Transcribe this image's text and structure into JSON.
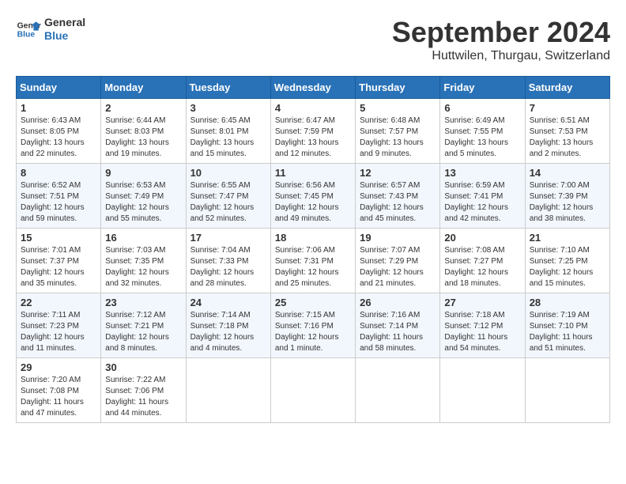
{
  "logo": {
    "line1": "General",
    "line2": "Blue"
  },
  "title": "September 2024",
  "subtitle": "Huttwilen, Thurgau, Switzerland",
  "headers": [
    "Sunday",
    "Monday",
    "Tuesday",
    "Wednesday",
    "Thursday",
    "Friday",
    "Saturday"
  ],
  "weeks": [
    [
      {
        "day": "1",
        "lines": [
          "Sunrise: 6:43 AM",
          "Sunset: 8:05 PM",
          "Daylight: 13 hours",
          "and 22 minutes."
        ]
      },
      {
        "day": "2",
        "lines": [
          "Sunrise: 6:44 AM",
          "Sunset: 8:03 PM",
          "Daylight: 13 hours",
          "and 19 minutes."
        ]
      },
      {
        "day": "3",
        "lines": [
          "Sunrise: 6:45 AM",
          "Sunset: 8:01 PM",
          "Daylight: 13 hours",
          "and 15 minutes."
        ]
      },
      {
        "day": "4",
        "lines": [
          "Sunrise: 6:47 AM",
          "Sunset: 7:59 PM",
          "Daylight: 13 hours",
          "and 12 minutes."
        ]
      },
      {
        "day": "5",
        "lines": [
          "Sunrise: 6:48 AM",
          "Sunset: 7:57 PM",
          "Daylight: 13 hours",
          "and 9 minutes."
        ]
      },
      {
        "day": "6",
        "lines": [
          "Sunrise: 6:49 AM",
          "Sunset: 7:55 PM",
          "Daylight: 13 hours",
          "and 5 minutes."
        ]
      },
      {
        "day": "7",
        "lines": [
          "Sunrise: 6:51 AM",
          "Sunset: 7:53 PM",
          "Daylight: 13 hours",
          "and 2 minutes."
        ]
      }
    ],
    [
      {
        "day": "8",
        "lines": [
          "Sunrise: 6:52 AM",
          "Sunset: 7:51 PM",
          "Daylight: 12 hours",
          "and 59 minutes."
        ]
      },
      {
        "day": "9",
        "lines": [
          "Sunrise: 6:53 AM",
          "Sunset: 7:49 PM",
          "Daylight: 12 hours",
          "and 55 minutes."
        ]
      },
      {
        "day": "10",
        "lines": [
          "Sunrise: 6:55 AM",
          "Sunset: 7:47 PM",
          "Daylight: 12 hours",
          "and 52 minutes."
        ]
      },
      {
        "day": "11",
        "lines": [
          "Sunrise: 6:56 AM",
          "Sunset: 7:45 PM",
          "Daylight: 12 hours",
          "and 49 minutes."
        ]
      },
      {
        "day": "12",
        "lines": [
          "Sunrise: 6:57 AM",
          "Sunset: 7:43 PM",
          "Daylight: 12 hours",
          "and 45 minutes."
        ]
      },
      {
        "day": "13",
        "lines": [
          "Sunrise: 6:59 AM",
          "Sunset: 7:41 PM",
          "Daylight: 12 hours",
          "and 42 minutes."
        ]
      },
      {
        "day": "14",
        "lines": [
          "Sunrise: 7:00 AM",
          "Sunset: 7:39 PM",
          "Daylight: 12 hours",
          "and 38 minutes."
        ]
      }
    ],
    [
      {
        "day": "15",
        "lines": [
          "Sunrise: 7:01 AM",
          "Sunset: 7:37 PM",
          "Daylight: 12 hours",
          "and 35 minutes."
        ]
      },
      {
        "day": "16",
        "lines": [
          "Sunrise: 7:03 AM",
          "Sunset: 7:35 PM",
          "Daylight: 12 hours",
          "and 32 minutes."
        ]
      },
      {
        "day": "17",
        "lines": [
          "Sunrise: 7:04 AM",
          "Sunset: 7:33 PM",
          "Daylight: 12 hours",
          "and 28 minutes."
        ]
      },
      {
        "day": "18",
        "lines": [
          "Sunrise: 7:06 AM",
          "Sunset: 7:31 PM",
          "Daylight: 12 hours",
          "and 25 minutes."
        ]
      },
      {
        "day": "19",
        "lines": [
          "Sunrise: 7:07 AM",
          "Sunset: 7:29 PM",
          "Daylight: 12 hours",
          "and 21 minutes."
        ]
      },
      {
        "day": "20",
        "lines": [
          "Sunrise: 7:08 AM",
          "Sunset: 7:27 PM",
          "Daylight: 12 hours",
          "and 18 minutes."
        ]
      },
      {
        "day": "21",
        "lines": [
          "Sunrise: 7:10 AM",
          "Sunset: 7:25 PM",
          "Daylight: 12 hours",
          "and 15 minutes."
        ]
      }
    ],
    [
      {
        "day": "22",
        "lines": [
          "Sunrise: 7:11 AM",
          "Sunset: 7:23 PM",
          "Daylight: 12 hours",
          "and 11 minutes."
        ]
      },
      {
        "day": "23",
        "lines": [
          "Sunrise: 7:12 AM",
          "Sunset: 7:21 PM",
          "Daylight: 12 hours",
          "and 8 minutes."
        ]
      },
      {
        "day": "24",
        "lines": [
          "Sunrise: 7:14 AM",
          "Sunset: 7:18 PM",
          "Daylight: 12 hours",
          "and 4 minutes."
        ]
      },
      {
        "day": "25",
        "lines": [
          "Sunrise: 7:15 AM",
          "Sunset: 7:16 PM",
          "Daylight: 12 hours",
          "and 1 minute."
        ]
      },
      {
        "day": "26",
        "lines": [
          "Sunrise: 7:16 AM",
          "Sunset: 7:14 PM",
          "Daylight: 11 hours",
          "and 58 minutes."
        ]
      },
      {
        "day": "27",
        "lines": [
          "Sunrise: 7:18 AM",
          "Sunset: 7:12 PM",
          "Daylight: 11 hours",
          "and 54 minutes."
        ]
      },
      {
        "day": "28",
        "lines": [
          "Sunrise: 7:19 AM",
          "Sunset: 7:10 PM",
          "Daylight: 11 hours",
          "and 51 minutes."
        ]
      }
    ],
    [
      {
        "day": "29",
        "lines": [
          "Sunrise: 7:20 AM",
          "Sunset: 7:08 PM",
          "Daylight: 11 hours",
          "and 47 minutes."
        ]
      },
      {
        "day": "30",
        "lines": [
          "Sunrise: 7:22 AM",
          "Sunset: 7:06 PM",
          "Daylight: 11 hours",
          "and 44 minutes."
        ]
      },
      {
        "day": "",
        "lines": []
      },
      {
        "day": "",
        "lines": []
      },
      {
        "day": "",
        "lines": []
      },
      {
        "day": "",
        "lines": []
      },
      {
        "day": "",
        "lines": []
      }
    ]
  ]
}
